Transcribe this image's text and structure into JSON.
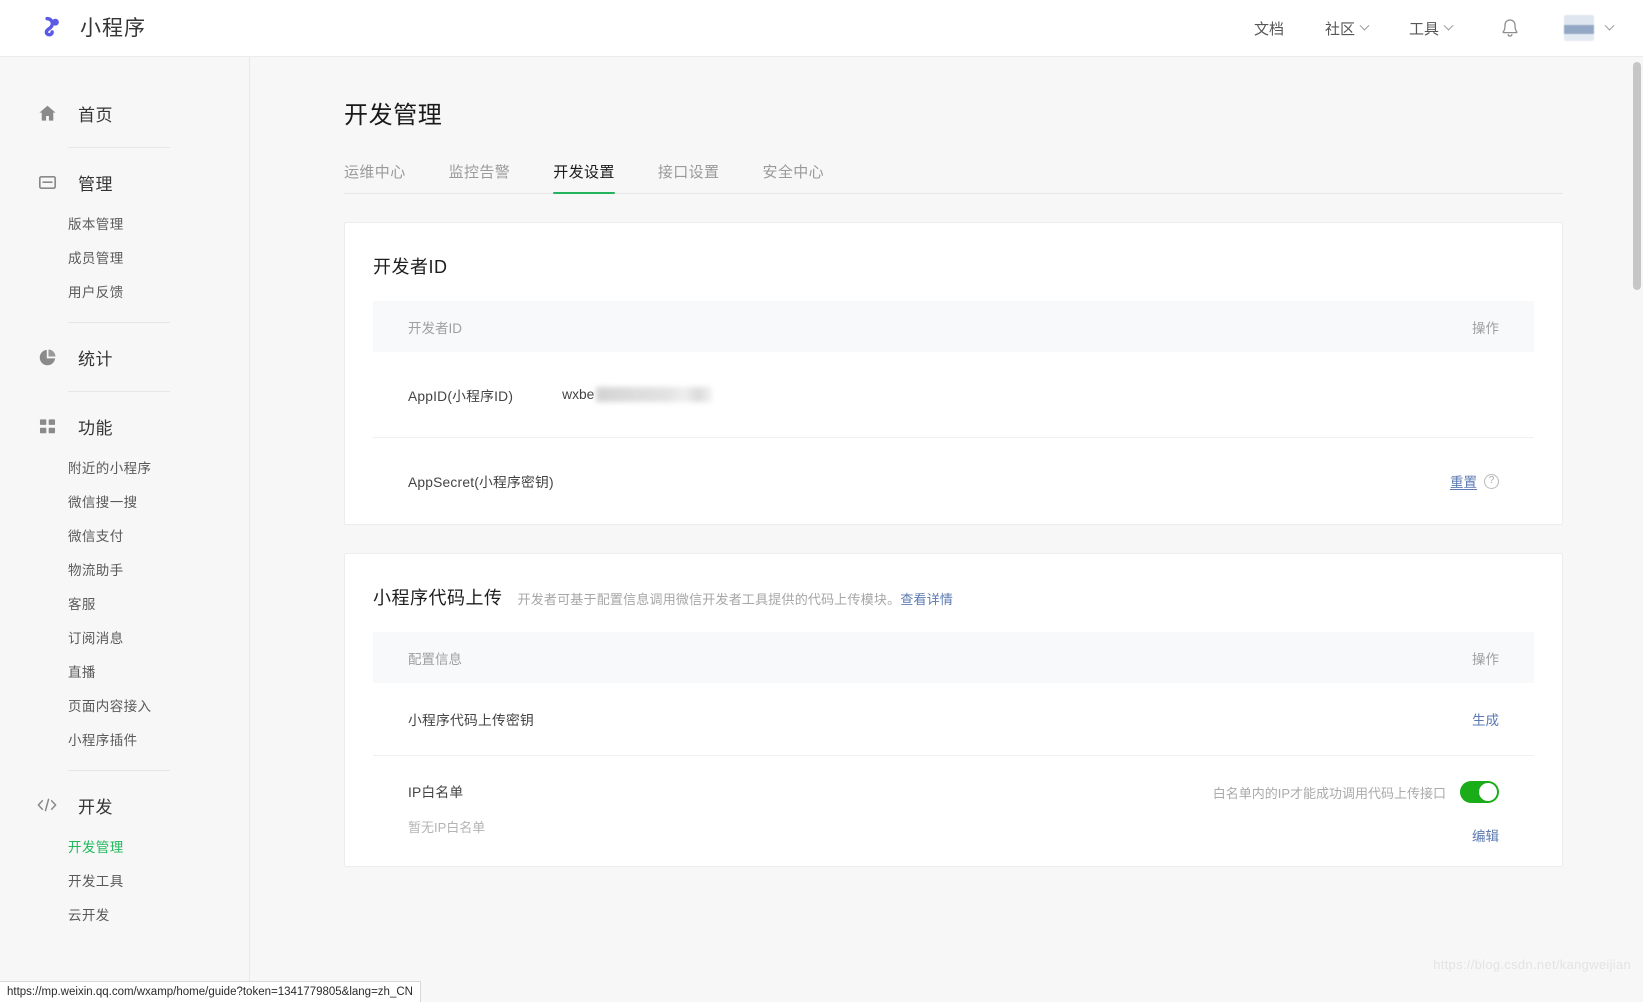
{
  "header": {
    "brand": "小程序",
    "nav": [
      {
        "label": "文档",
        "has_caret": false
      },
      {
        "label": "社区",
        "has_caret": true
      },
      {
        "label": "工具",
        "has_caret": true
      }
    ],
    "bell_icon": "bell-icon",
    "avatar_caret": "chevron-down-icon"
  },
  "sidebar": {
    "groups": [
      {
        "icon": "home-icon",
        "label": "首页",
        "items": []
      },
      {
        "icon": "inbox-icon",
        "label": "管理",
        "items": [
          {
            "label": "版本管理",
            "active": false
          },
          {
            "label": "成员管理",
            "active": false
          },
          {
            "label": "用户反馈",
            "active": false
          }
        ]
      },
      {
        "icon": "pie-chart-icon",
        "label": "统计",
        "items": []
      },
      {
        "icon": "grid-icon",
        "label": "功能",
        "items": [
          {
            "label": "附近的小程序",
            "active": false
          },
          {
            "label": "微信搜一搜",
            "active": false
          },
          {
            "label": "微信支付",
            "active": false
          },
          {
            "label": "物流助手",
            "active": false
          },
          {
            "label": "客服",
            "active": false
          },
          {
            "label": "订阅消息",
            "active": false
          },
          {
            "label": "直播",
            "active": false
          },
          {
            "label": "页面内容接入",
            "active": false
          },
          {
            "label": "小程序插件",
            "active": false
          }
        ]
      },
      {
        "icon": "code-icon",
        "label": "开发",
        "items": [
          {
            "label": "开发管理",
            "active": true
          },
          {
            "label": "开发工具",
            "active": false
          },
          {
            "label": "云开发",
            "active": false
          }
        ]
      }
    ]
  },
  "main": {
    "page_title": "开发管理",
    "tabs": [
      {
        "label": "运维中心",
        "active": false
      },
      {
        "label": "监控告警",
        "active": false
      },
      {
        "label": "开发设置",
        "active": true
      },
      {
        "label": "接口设置",
        "active": false
      },
      {
        "label": "安全中心",
        "active": false
      }
    ],
    "cards": [
      {
        "title": "开发者ID",
        "desc": "",
        "desc_link": "",
        "columns": {
          "info": "开发者ID",
          "operation": "操作"
        },
        "rows": [
          {
            "label": "AppID(小程序ID)",
            "value": "wxbe",
            "value_masked": true,
            "action": "",
            "action_underline": false,
            "has_help": false
          },
          {
            "label": "AppSecret(小程序密钥)",
            "value": "",
            "value_masked": false,
            "action": "重置",
            "action_underline": true,
            "has_help": true
          }
        ]
      },
      {
        "title": "小程序代码上传",
        "desc": "开发者可基于配置信息调用微信开发者工具提供的代码上传模块。",
        "desc_link": "查看详情",
        "columns": {
          "info": "配置信息",
          "operation": "操作"
        },
        "rows": [
          {
            "label": "小程序代码上传密钥",
            "value": "",
            "value_masked": false,
            "action": "生成",
            "action_underline": false,
            "has_help": false
          },
          {
            "label": "IP白名单",
            "sub_label": "暂无IP白名单",
            "hint": "白名单内的IP才能成功调用代码上传接口",
            "toggle_on": true,
            "sub_action": "编辑"
          }
        ]
      }
    ]
  },
  "statusbar": {
    "url": "https://mp.weixin.qq.com/wxamp/home/guide?token=1341779805&lang=zh_CN"
  },
  "watermark": "https://blog.csdn.net/kangweijian",
  "colors": {
    "accent_green": "#21b95c",
    "toggle_green": "#1aad19",
    "link_blue": "#5b79b0",
    "brand_purple": "#5a5ae6"
  }
}
